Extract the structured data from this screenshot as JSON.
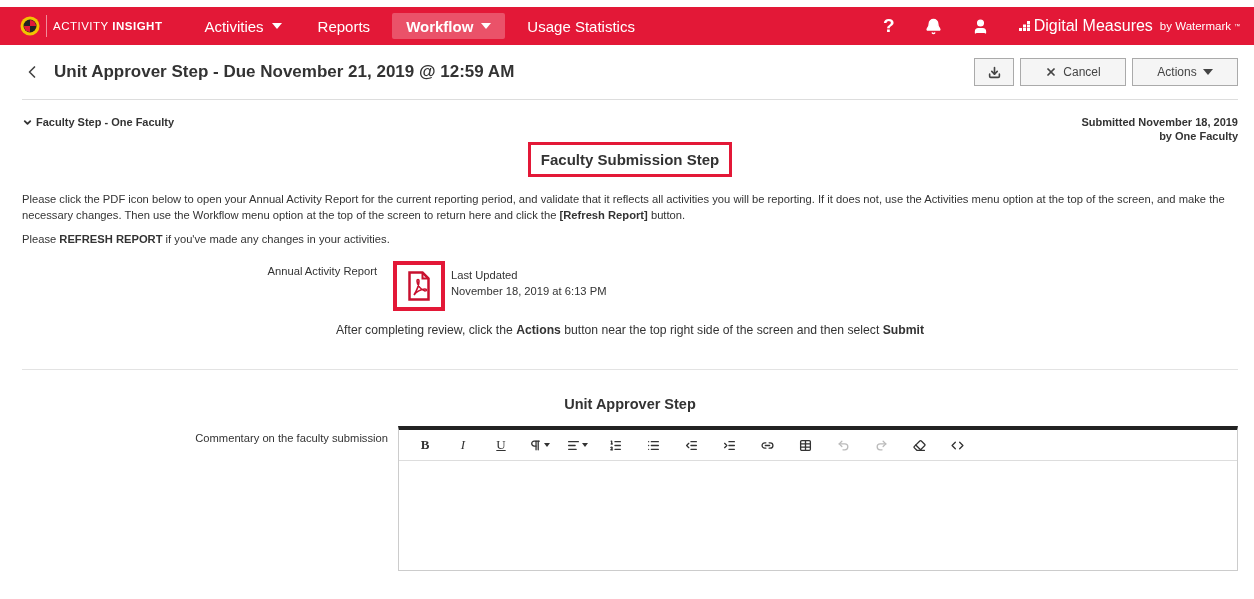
{
  "nav": {
    "logo": {
      "light": "ACTIVITY",
      "bold": "INSIGHT"
    },
    "items": [
      {
        "label": "Activities",
        "has_menu": true,
        "selected": false
      },
      {
        "label": "Reports",
        "has_menu": false,
        "selected": false
      },
      {
        "label": "Workflow",
        "has_menu": true,
        "selected": true
      },
      {
        "label": "Usage Statistics",
        "has_menu": false,
        "selected": false
      }
    ],
    "help": "?",
    "brand": {
      "name": "Digital Measures",
      "by": "by Watermark",
      "tm": "™"
    }
  },
  "header": {
    "title": "Unit Approver Step - Due November 21, 2019 @ 12:59 AM",
    "cancel": "Cancel",
    "actions": "Actions"
  },
  "faculty_step": {
    "label": "Faculty Step - One Faculty",
    "expanded": true,
    "submitted": "Submitted November 18, 2019",
    "submitted_by": "by One Faculty",
    "heading": "Faculty Submission Step",
    "heading_highlighted": true,
    "instructions": "Please click the PDF icon below to open your Annual Activity Report for the current reporting period, and validate that it reflects all activities you will be reporting. If it does not, use the Activities menu option at the top of the screen, and make the necessary changes. Then use the Workflow menu option at the top of the screen to return here and click the **[Refresh Report]** button.",
    "refresh_note": "Please **REFRESH REPORT** if you've made any changes in your activities.",
    "report": {
      "label": "Annual Activity Report",
      "icon_highlighted": true,
      "updated_label": "Last Updated",
      "updated": "November 18, 2019 at 6:13 PM"
    },
    "after_note": "After completing review, click the **Actions** button near the top right side of the screen and then select **Submit**"
  },
  "approver_step": {
    "heading": "Unit Approver Step",
    "comment_label": "Commentary on the faculty submission",
    "toolbar": [
      {
        "kind": "bold",
        "text": "B",
        "disabled": false
      },
      {
        "kind": "italic",
        "text": "I",
        "disabled": false
      },
      {
        "kind": "underline",
        "text": "U",
        "disabled": false
      },
      {
        "kind": "paragraph",
        "disabled": false
      },
      {
        "kind": "align",
        "disabled": false
      },
      {
        "kind": "ordered-list",
        "disabled": false
      },
      {
        "kind": "bullet-list",
        "disabled": false
      },
      {
        "kind": "outdent",
        "disabled": false
      },
      {
        "kind": "indent",
        "disabled": false
      },
      {
        "kind": "link",
        "disabled": false
      },
      {
        "kind": "table",
        "disabled": false
      },
      {
        "kind": "undo",
        "disabled": true
      },
      {
        "kind": "redo",
        "disabled": true
      },
      {
        "kind": "eraser",
        "disabled": false
      },
      {
        "kind": "code",
        "disabled": false
      }
    ]
  }
}
